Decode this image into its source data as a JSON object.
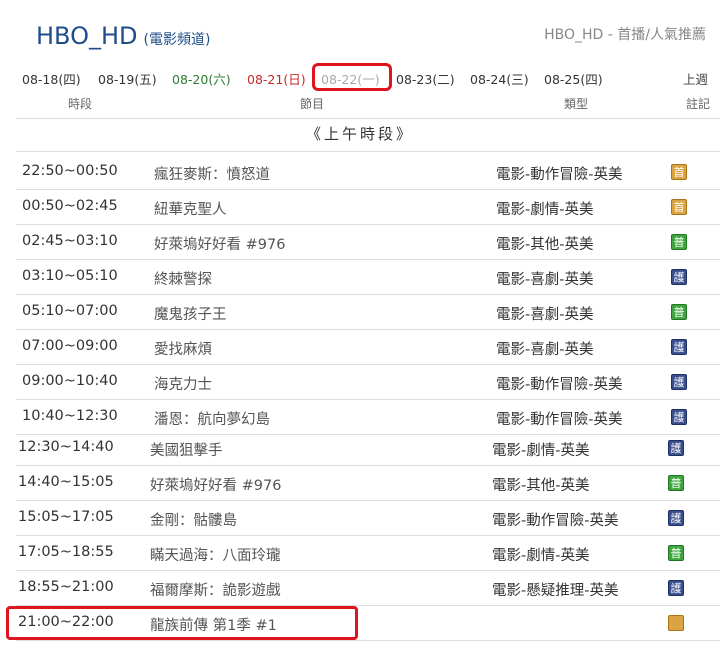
{
  "header": {
    "channel": "HBO_HD",
    "channel_sub": "(電影頻道)",
    "right_link": "HBO_HD - 首播/人氣推薦"
  },
  "dates": [
    {
      "label": "08-18(四)",
      "style": "normal"
    },
    {
      "label": "08-19(五)",
      "style": "normal"
    },
    {
      "label": "08-20(六)",
      "style": "green"
    },
    {
      "label": "08-21(日)",
      "style": "red"
    },
    {
      "label": "08-22(一)",
      "style": "gray"
    },
    {
      "label": "08-23(二)",
      "style": "normal"
    },
    {
      "label": "08-24(三)",
      "style": "normal"
    },
    {
      "label": "08-25(四)",
      "style": "normal"
    }
  ],
  "prev_week": "上週",
  "columns": {
    "time": "時段",
    "program": "節目",
    "genre": "類型",
    "note": "註記"
  },
  "section_title": "《上午時段》",
  "rows": [
    {
      "time": "22:50~00:50",
      "program": "瘋狂麥斯：憤怒道",
      "genre": "電影-動作冒險-英美",
      "badge": "orange",
      "badge_text": "首"
    },
    {
      "time": "00:50~02:45",
      "program": "紐華克聖人",
      "genre": "電影-劇情-英美",
      "badge": "orange",
      "badge_text": "首"
    },
    {
      "time": "02:45~03:10",
      "program": "好萊塢好好看 #976",
      "genre": "電影-其他-英美",
      "badge": "green",
      "badge_text": "普"
    },
    {
      "time": "03:10~05:10",
      "program": "終棘警探",
      "genre": "電影-喜劇-英美",
      "badge": "navy",
      "badge_text": "護"
    },
    {
      "time": "05:10~07:00",
      "program": "魔鬼孩子王",
      "genre": "電影-喜劇-英美",
      "badge": "green",
      "badge_text": "普"
    },
    {
      "time": "07:00~09:00",
      "program": "愛找麻煩",
      "genre": "電影-喜劇-英美",
      "badge": "navy",
      "badge_text": "護"
    },
    {
      "time": "09:00~10:40",
      "program": "海克力士",
      "genre": "電影-動作冒險-英美",
      "badge": "navy",
      "badge_text": "護"
    },
    {
      "time": "10:40~12:30",
      "program": "潘恩：航向夢幻島",
      "genre": "電影-動作冒險-英美",
      "badge": "navy",
      "badge_text": "護"
    }
  ],
  "rows_b": [
    {
      "time": "12:30~14:40",
      "program": "美國狙擊手",
      "genre": "電影-劇情-英美",
      "badge": "navy",
      "badge_text": "護"
    },
    {
      "time": "14:40~15:05",
      "program": "好萊塢好好看 #976",
      "genre": "電影-其他-英美",
      "badge": "green",
      "badge_text": "普"
    },
    {
      "time": "15:05~17:05",
      "program": "金剛：骷髏島",
      "genre": "電影-動作冒險-英美",
      "badge": "navy",
      "badge_text": "護"
    },
    {
      "time": "17:05~18:55",
      "program": "瞞天過海：八面玲瓏",
      "genre": "電影-劇情-英美",
      "badge": "green",
      "badge_text": "普"
    },
    {
      "time": "18:55~21:00",
      "program": "福爾摩斯：詭影遊戲",
      "genre": "電影-懸疑推理-英美",
      "badge": "navy",
      "badge_text": "護"
    },
    {
      "time": "21:00~22:00",
      "program": "龍族前傳 第1季 #1",
      "genre": "",
      "badge": "orange",
      "badge_text": ""
    }
  ],
  "colors": {
    "brand_blue": "#1f4d8a",
    "highlight_red": "#e0141e",
    "weekend_green": "#2e7d32",
    "sunday_red": "#c62828"
  }
}
